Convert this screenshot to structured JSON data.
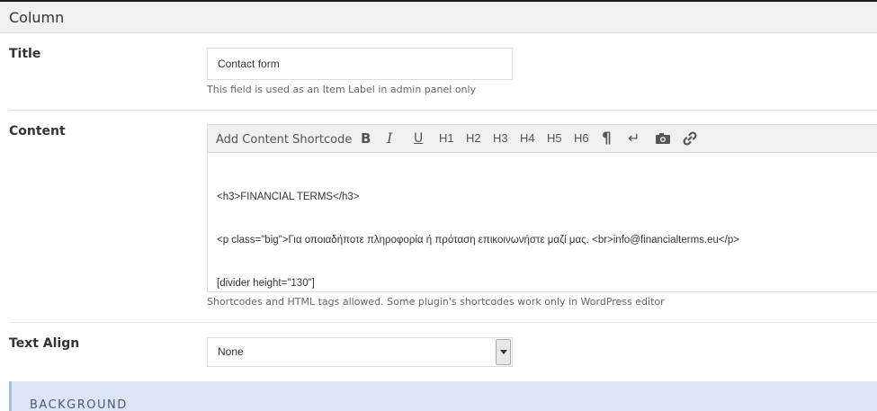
{
  "header": {
    "title": "Column"
  },
  "fields": {
    "title": {
      "label": "Title",
      "value": "Contact form",
      "description": "This field is used as an Item Label in admin panel only"
    },
    "content": {
      "label": "Content",
      "toolbar": {
        "shortcode_label": "Add Content Shortcode",
        "bold": "B",
        "italic": "I",
        "underline": "U",
        "h1": "H1",
        "h2": "H2",
        "h3": "H3",
        "h4": "H4",
        "h5": "H5",
        "h6": "H6",
        "paragraph": "¶",
        "line_break": "↵",
        "icons": [
          "bold-icon",
          "italic-icon",
          "underline-icon",
          "paragraph-icon",
          "line-break-icon",
          "image-icon",
          "link-icon"
        ]
      },
      "lines": [
        "<h3>FINANCIAL TERMS</h3>",
        "<p class=\"big\">Για οποιαδήποτε πληροφορία ή πρόταση επικοινωνήστε μαζί μας. <br>info@financialterms.eu</p>",
        "[divider height=\"130\"]"
      ],
      "description": "Shortcodes and HTML tags allowed. Some plugin's shortcodes work only in WordPress editor"
    },
    "text_align": {
      "label": "Text Align",
      "selected": "None"
    }
  },
  "background_section": {
    "title": "BACKGROUND"
  },
  "colors": {
    "section_bg": "#dbe5f5",
    "header_bg": "#f0f0f0"
  }
}
